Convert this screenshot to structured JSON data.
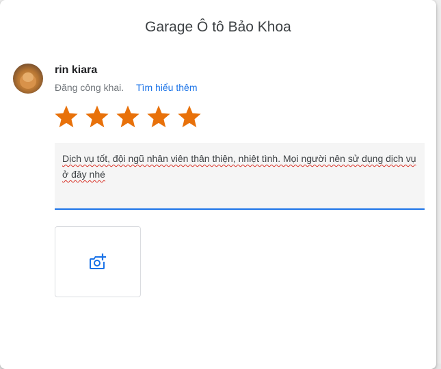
{
  "dialog": {
    "title": "Garage Ô tô Bảo Khoa"
  },
  "user": {
    "name": "rin kiara",
    "post_status": "Đăng công khai.",
    "learn_more": "Tìm hiểu thêm"
  },
  "rating": {
    "value": 5,
    "max": 5,
    "star_color": "#e8710a"
  },
  "review": {
    "text": "Dịch vụ tốt, đội ngũ nhân viên thân thiện, nhiệt tình. Mọi người nên sử dụng dịch vụ ở đây nhé"
  },
  "photo": {
    "icon": "add-photo-icon",
    "accent_color": "#1a73e8"
  }
}
